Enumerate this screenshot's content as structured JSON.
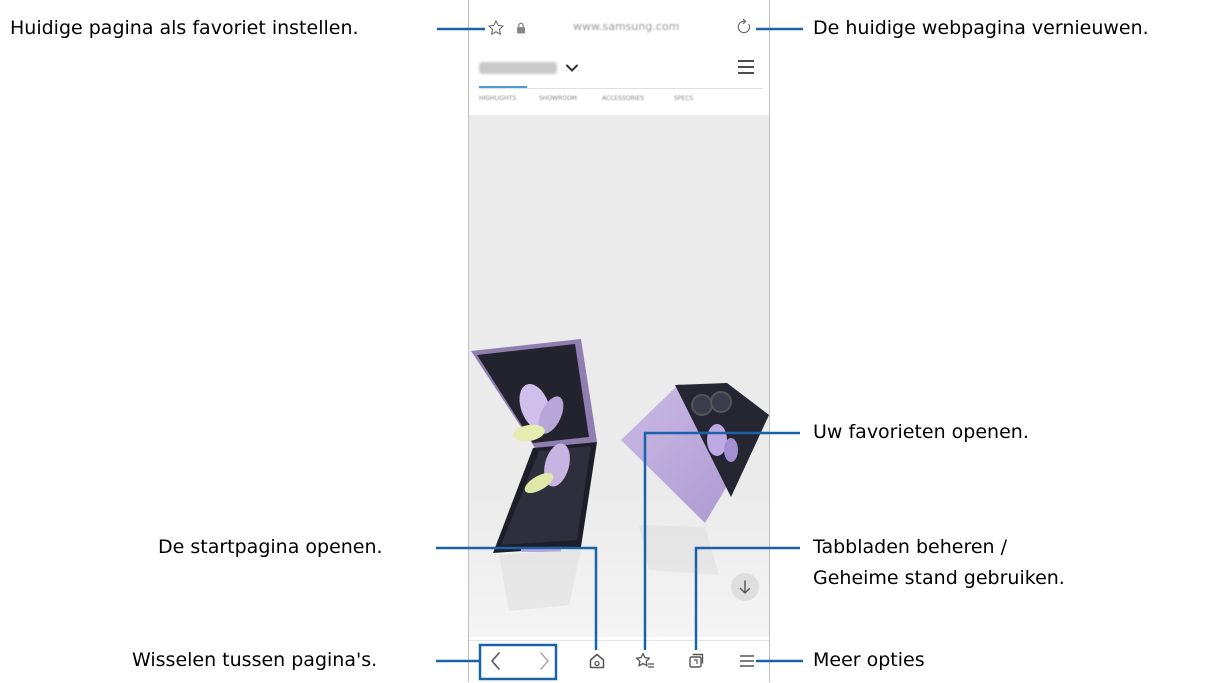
{
  "browser": {
    "url": "www.samsung.com",
    "menu_items": [
      "HIGHLIGHTS",
      "SHOWROOM",
      "ACCESSORIES",
      "SPECS"
    ]
  },
  "callouts": {
    "bookmark": "Huidige pagina als favoriet instellen.",
    "refresh": "De huidige webpagina vernieuwen.",
    "favorites": "Uw favorieten openen.",
    "home": "De startpagina openen.",
    "tabs_line1": "Tabbladen beheren /",
    "tabs_line2": "Geheime stand gebruiken.",
    "back_forward": "Wisselen tussen pagina's.",
    "more": "Meer opties"
  },
  "colors": {
    "callout_line": "#1b63a8",
    "phone_violet": "#b9a6d8",
    "phone_dark": "#2a2a38"
  }
}
